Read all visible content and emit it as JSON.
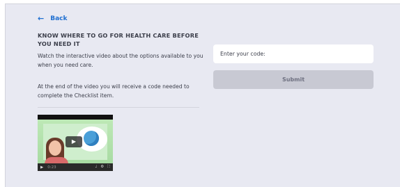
{
  "nav": {
    "back_label": "Back",
    "back_icon": "arrow-left-icon"
  },
  "content": {
    "heading": "KNOW WHERE TO GO FOR HEALTH CARE BEFORE YOU NEED IT",
    "paragraph1": "Watch the interactive video about the options available to you when you need care.",
    "paragraph2": "At the end of the video you will receive a code needed to complete the Checklist item."
  },
  "video": {
    "time": "0:23",
    "play_icon": "play-icon",
    "volume_icon": "volume-icon",
    "settings_icon": "gear-icon",
    "fullscreen_icon": "fullscreen-icon"
  },
  "form": {
    "code_placeholder": "Enter your code:",
    "code_value": "",
    "submit_label": "Submit"
  },
  "colors": {
    "accent": "#1f6fd1",
    "background": "#e8e9f2",
    "button_disabled": "#c8c9d3"
  }
}
